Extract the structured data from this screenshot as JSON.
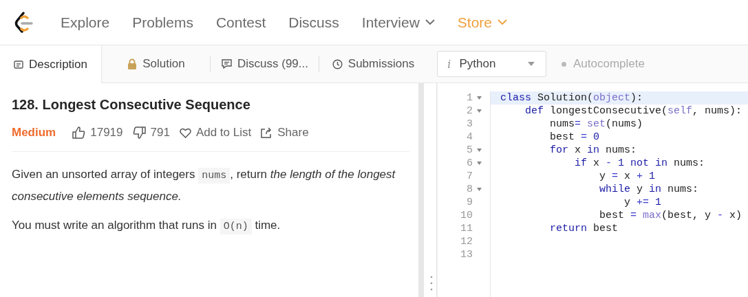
{
  "nav": [
    {
      "label": "Explore",
      "dropdown": false,
      "accent": false
    },
    {
      "label": "Problems",
      "dropdown": false,
      "accent": false
    },
    {
      "label": "Contest",
      "dropdown": false,
      "accent": false
    },
    {
      "label": "Discuss",
      "dropdown": false,
      "accent": false
    },
    {
      "label": "Interview",
      "dropdown": true,
      "accent": false
    },
    {
      "label": "Store",
      "dropdown": true,
      "accent": true
    }
  ],
  "tabs": [
    {
      "label": "Description",
      "selected": true
    },
    {
      "label": "Solution",
      "selected": false
    },
    {
      "label": "Discuss (99...",
      "selected": false
    },
    {
      "label": "Submissions",
      "selected": false
    }
  ],
  "language": {
    "glyph": "i",
    "value": "Python"
  },
  "autocomplete": {
    "label": "Autocomplete",
    "on": false
  },
  "problem": {
    "title": "128. Longest Consecutive Sequence",
    "difficulty": "Medium",
    "likes": "17919",
    "dislikes": "791",
    "add_to_list": "Add to List",
    "share": "Share",
    "paragraphs": [
      [
        {
          "kind": "text",
          "t": "Given an unsorted array of integers "
        },
        {
          "kind": "code",
          "t": "nums"
        },
        {
          "kind": "text",
          "t": ", return *the length of the longest consecutive elements sequence.*"
        }
      ],
      [
        {
          "kind": "text",
          "t": "You must write an algorithm that runs in "
        },
        {
          "kind": "code",
          "t": "O(n)"
        },
        {
          "kind": "text",
          "t": " time."
        }
      ]
    ]
  },
  "editor": {
    "lines": [
      {
        "number": "1",
        "foldable": true,
        "selected": true,
        "tokens": [
          {
            "kind": "kw",
            "t": "class"
          },
          {
            "kind": "text",
            "t": " Solution("
          },
          {
            "kind": "builtin",
            "t": "object"
          },
          {
            "kind": "text",
            "t": "):"
          }
        ]
      },
      {
        "number": "2",
        "foldable": true,
        "selected": false,
        "tokens": [
          {
            "kind": "kw",
            "t": "    def"
          },
          {
            "kind": "text",
            "t": " longestConsecutive("
          },
          {
            "kind": "builtin",
            "t": "self"
          },
          {
            "kind": "text",
            "t": ", nums):"
          }
        ]
      },
      {
        "number": "3",
        "foldable": false,
        "selected": false,
        "tokens": [
          {
            "kind": "text",
            "t": "        nums"
          },
          {
            "kind": "op",
            "t": "= "
          },
          {
            "kind": "builtin",
            "t": "set"
          },
          {
            "kind": "text",
            "t": "(nums)"
          }
        ]
      },
      {
        "number": "4",
        "foldable": false,
        "selected": false,
        "tokens": [
          {
            "kind": "text",
            "t": "        best "
          },
          {
            "kind": "op",
            "t": "= "
          },
          {
            "kind": "num",
            "t": "0"
          }
        ]
      },
      {
        "number": "5",
        "foldable": true,
        "selected": false,
        "tokens": [
          {
            "kind": "kw",
            "t": "        for"
          },
          {
            "kind": "text",
            "t": " x "
          },
          {
            "kind": "kw",
            "t": "in"
          },
          {
            "kind": "text",
            "t": " nums:"
          }
        ]
      },
      {
        "number": "6",
        "foldable": true,
        "selected": false,
        "tokens": [
          {
            "kind": "kw",
            "t": "            if"
          },
          {
            "kind": "text",
            "t": " x "
          },
          {
            "kind": "op",
            "t": "- "
          },
          {
            "kind": "num",
            "t": "1 "
          },
          {
            "kind": "kw",
            "t": "not in"
          },
          {
            "kind": "text",
            "t": " nums:"
          }
        ]
      },
      {
        "number": "7",
        "foldable": false,
        "selected": false,
        "tokens": [
          {
            "kind": "text",
            "t": "                y "
          },
          {
            "kind": "op",
            "t": "= "
          },
          {
            "kind": "text",
            "t": "x "
          },
          {
            "kind": "op",
            "t": "+ "
          },
          {
            "kind": "num",
            "t": "1"
          }
        ]
      },
      {
        "number": "8",
        "foldable": true,
        "selected": false,
        "tokens": [
          {
            "kind": "kw",
            "t": "                while"
          },
          {
            "kind": "text",
            "t": " y "
          },
          {
            "kind": "kw",
            "t": "in"
          },
          {
            "kind": "text",
            "t": " nums:"
          }
        ]
      },
      {
        "number": "9",
        "foldable": false,
        "selected": false,
        "tokens": [
          {
            "kind": "text",
            "t": "                    y "
          },
          {
            "kind": "op",
            "t": "+= "
          },
          {
            "kind": "num",
            "t": "1"
          }
        ]
      },
      {
        "number": "10",
        "foldable": false,
        "selected": false,
        "tokens": [
          {
            "kind": "text",
            "t": "                best "
          },
          {
            "kind": "op",
            "t": "= "
          },
          {
            "kind": "builtin",
            "t": "max"
          },
          {
            "kind": "text",
            "t": "(best, y "
          },
          {
            "kind": "op",
            "t": "- "
          },
          {
            "kind": "text",
            "t": "x)"
          }
        ]
      },
      {
        "number": "11",
        "foldable": false,
        "selected": false,
        "tokens": [
          {
            "kind": "kw",
            "t": "        return"
          },
          {
            "kind": "text",
            "t": " best"
          }
        ]
      },
      {
        "number": "12",
        "foldable": false,
        "selected": false
      },
      {
        "number": "13",
        "foldable": false,
        "selected": false
      }
    ]
  }
}
